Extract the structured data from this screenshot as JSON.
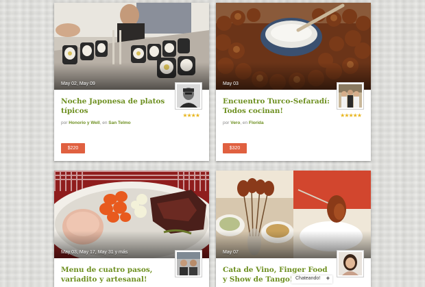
{
  "cards": [
    {
      "date": "May 02, May 09",
      "title": "Noche Japonesa de platos típicos",
      "meta_prefix": "por",
      "host": "Honorio y Well",
      "meta_mid": ", en",
      "location": "San Telmo",
      "rating": "★★★★",
      "price": "$220"
    },
    {
      "date": "May 03",
      "title": "Encuentro Turco-Sefaradí: Todos cocinan!",
      "meta_prefix": "por",
      "host": "Vero",
      "meta_mid": ", en",
      "location": "Florida",
      "rating": "★★★★★",
      "price": "$320"
    },
    {
      "date": "May 03, May 17, May 31 y más",
      "title": "Menu de cuatro pasos, variadito y artesanal!"
    },
    {
      "date": "May 07",
      "title": "Cata de Vino, Finger Food y Show de Tango!"
    }
  ],
  "chat": {
    "label": "Chateando!",
    "toggle": "+"
  }
}
